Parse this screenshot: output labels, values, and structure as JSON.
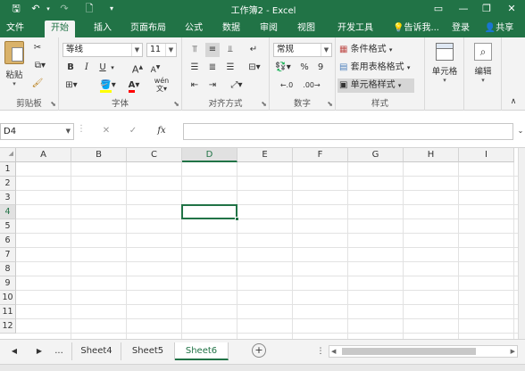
{
  "window": {
    "title": "工作簿2 - Excel",
    "brand_color": "#217346"
  },
  "qat": {
    "save": "🖫",
    "undo": "↶",
    "redo": "↷",
    "new": "🗋",
    "customize": "▾"
  },
  "window_controls": {
    "ribbon_options": "▭",
    "minimize": "—",
    "restore": "❐",
    "close": "✕"
  },
  "tabs": [
    "文件",
    "开始",
    "插入",
    "页面布局",
    "公式",
    "数据",
    "审阅",
    "视图",
    "开发工具"
  ],
  "active_tab": "开始",
  "tell_me": "告诉我...",
  "signin": "登录",
  "share": "共享",
  "ribbon": {
    "clipboard": {
      "label": "剪贴板",
      "paste": "粘贴"
    },
    "font": {
      "label": "字体",
      "font_name": "等线",
      "font_size": "11",
      "bold": "B",
      "italic": "I",
      "underline": "U",
      "grow": "A",
      "shrink": "A",
      "wen": "wén"
    },
    "alignment": {
      "label": "对齐方式"
    },
    "number": {
      "label": "数字",
      "format": "常规",
      "percent": "%",
      "comma": "9"
    },
    "styles": {
      "label": "样式",
      "conditional": "条件格式",
      "table": "套用表格格式",
      "cell": "单元格样式"
    },
    "cells": {
      "label": "单元格"
    },
    "editing": {
      "label": "编辑"
    }
  },
  "formula_bar": {
    "name_box": "D4",
    "cancel": "✕",
    "enter": "✓",
    "fx": "fx",
    "value": ""
  },
  "columns": [
    "A",
    "B",
    "C",
    "D",
    "E",
    "F",
    "G",
    "H",
    "I"
  ],
  "rows": [
    "1",
    "2",
    "3",
    "4",
    "5",
    "6",
    "7",
    "8",
    "9",
    "10",
    "11",
    "12"
  ],
  "active_cell": {
    "column": "D",
    "row": "4"
  },
  "sheets": {
    "ellipsis": "...",
    "items": [
      "Sheet4",
      "Sheet5",
      "Sheet6"
    ],
    "active": "Sheet6",
    "add": "+"
  }
}
